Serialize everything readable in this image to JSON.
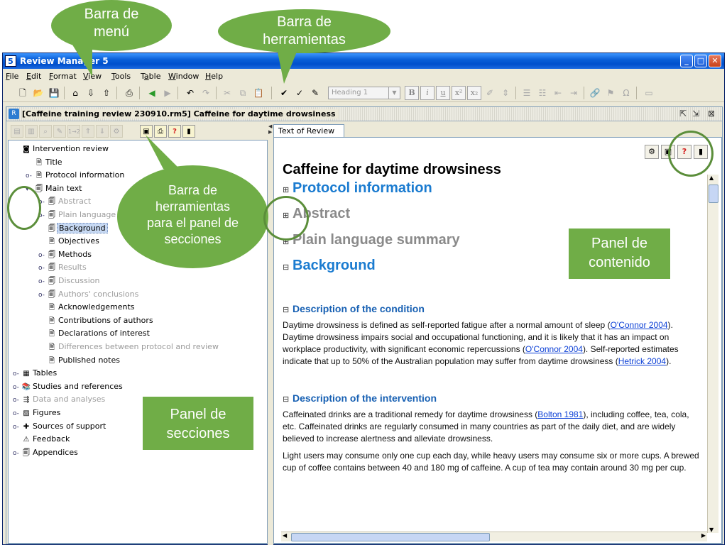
{
  "window": {
    "title": "Review Manager 5",
    "app_icon": "5",
    "controls": [
      "minimize",
      "maximize",
      "close"
    ]
  },
  "menubar": [
    {
      "mnemonic": "F",
      "rest": "ile"
    },
    {
      "mnemonic": "E",
      "rest": "dit"
    },
    {
      "mnemonic": "F",
      "rest": "ormat"
    },
    {
      "mnemonic": "V",
      "rest": "iew"
    },
    {
      "mnemonic": "T",
      "rest": "ools"
    },
    {
      "pre": "T",
      "mnemonic": "a",
      "rest": "ble"
    },
    {
      "mnemonic": "W",
      "rest": "indow"
    },
    {
      "mnemonic": "H",
      "rest": "elp"
    }
  ],
  "toolbar": {
    "style_select": "Heading 1",
    "format_buttons": [
      "B",
      "i",
      "u",
      "x²",
      "x₂"
    ],
    "special_char": "Ω"
  },
  "document": {
    "frame_title": "[Caffeine training review 230910.rm5] Caffeine for daytime drowsiness",
    "frame_controls": [
      "restore",
      "maximize",
      "close"
    ]
  },
  "sections_toolbar": {
    "renumber": "1→2"
  },
  "tree": [
    {
      "label": "Intervention review",
      "level": 0,
      "icon": "review-icon",
      "expander": "",
      "grey": false
    },
    {
      "label": "Title",
      "level": 1,
      "icon": "doc-icon",
      "expander": "",
      "grey": false
    },
    {
      "label": "Protocol information",
      "level": 1,
      "icon": "doc-icon",
      "expander": "o-",
      "grey": false
    },
    {
      "label": "Main text",
      "level": 1,
      "icon": "book-icon",
      "expander": "▾",
      "grey": false
    },
    {
      "label": "Abstract",
      "level": 2,
      "icon": "book-icon",
      "expander": "o-",
      "grey": true
    },
    {
      "label": "Plain language summary",
      "level": 2,
      "icon": "book-icon",
      "expander": "o-",
      "grey": true
    },
    {
      "label": "Background",
      "level": 2,
      "icon": "book-icon",
      "expander": "",
      "grey": false,
      "selected": true
    },
    {
      "label": "Objectives",
      "level": 2,
      "icon": "doc-icon",
      "expander": "",
      "grey": false
    },
    {
      "label": "Methods",
      "level": 2,
      "icon": "book-icon",
      "expander": "o-",
      "grey": false
    },
    {
      "label": "Results",
      "level": 2,
      "icon": "book-icon",
      "expander": "o-",
      "grey": true
    },
    {
      "label": "Discussion",
      "level": 2,
      "icon": "book-icon",
      "expander": "o-",
      "grey": true
    },
    {
      "label": "Authors' conclusions",
      "level": 2,
      "icon": "book-icon",
      "expander": "o-",
      "grey": true
    },
    {
      "label": "Acknowledgements",
      "level": 2,
      "icon": "doc-icon",
      "expander": "",
      "grey": false
    },
    {
      "label": "Contributions of authors",
      "level": 2,
      "icon": "doc-icon",
      "expander": "",
      "grey": false
    },
    {
      "label": "Declarations of interest",
      "level": 2,
      "icon": "doc-icon",
      "expander": "",
      "grey": false
    },
    {
      "label": "Differences between protocol and review",
      "level": 2,
      "icon": "doc-icon",
      "expander": "",
      "grey": true
    },
    {
      "label": "Published notes",
      "level": 2,
      "icon": "doc-icon",
      "expander": "",
      "grey": false
    },
    {
      "label": "Tables",
      "level": 0,
      "icon": "table-icon",
      "expander": "o-",
      "grey": false
    },
    {
      "label": "Studies and references",
      "level": 0,
      "icon": "books-icon",
      "expander": "o-",
      "grey": false
    },
    {
      "label": "Data and analyses",
      "level": 0,
      "icon": "data-icon",
      "expander": "o-",
      "grey": true
    },
    {
      "label": "Figures",
      "level": 0,
      "icon": "figure-icon",
      "expander": "o-",
      "grey": false
    },
    {
      "label": "Sources of support",
      "level": 0,
      "icon": "support-icon",
      "expander": "o-",
      "grey": false
    },
    {
      "label": "Feedback",
      "level": 0,
      "icon": "feedback-icon",
      "expander": "",
      "grey": false
    },
    {
      "label": "Appendices",
      "level": 0,
      "icon": "book-icon",
      "expander": "o-",
      "grey": false
    }
  ],
  "content": {
    "tab": "Text of Review",
    "title": "Caffeine for daytime drowsiness",
    "headings": [
      {
        "text": "Protocol information",
        "toggle": "⊞",
        "style": "blue"
      },
      {
        "text": "Abstract",
        "toggle": "⊞",
        "style": "grey"
      },
      {
        "text": "Plain language summary",
        "toggle": "⊞",
        "style": "grey"
      },
      {
        "text": "Background",
        "toggle": "⊟",
        "style": "blue"
      }
    ],
    "sub1": {
      "toggle": "⊟",
      "text": "Description of the condition"
    },
    "para1": [
      {
        "t": "Daytime drowsiness is defined as self-reported fatigue after a normal amount of sleep ("
      },
      {
        "t": "O'Connor 2004",
        "link": true
      },
      {
        "t": "). Daytime drowsiness impairs social and occupational functioning, and it is likely that it has an impact on workplace productivity, with significant economic repercussions ("
      },
      {
        "t": "O'Connor 2004",
        "link": true
      },
      {
        "t": "). Self-reported estimates indicate that up to 50% of the Australian population may suffer from daytime drowsiness ("
      },
      {
        "t": "Hetrick 2004",
        "link": true
      },
      {
        "t": ")."
      }
    ],
    "sub2": {
      "toggle": "⊟",
      "text": "Description of the intervention"
    },
    "para2": [
      {
        "t": "Caffeinated drinks are a traditional remedy for daytime drowsiness ("
      },
      {
        "t": "Bolton 1981",
        "link": true
      },
      {
        "t": "), including coffee, tea, cola, etc. Caffeinated drinks are regularly consumed in many countries as part of the daily diet, and are widely believed to increase alertness and alleviate drowsiness."
      }
    ],
    "para3": "Light users may consume only one cup each day, while heavy users may consume six or more cups. A brewed cup of coffee contains between 40 and 180 mg of caffeine. A cup of tea may contain around 30 mg per cup."
  },
  "annotations": {
    "menu_bar": "Barra de menú",
    "toolbar": "Barra de herramientas",
    "sections_toolbar": "Barra de herramientas para el panel de secciones",
    "content_panel": "Panel de contenido",
    "sections_panel": "Panel de secciones",
    "accent": "#70ad47"
  }
}
